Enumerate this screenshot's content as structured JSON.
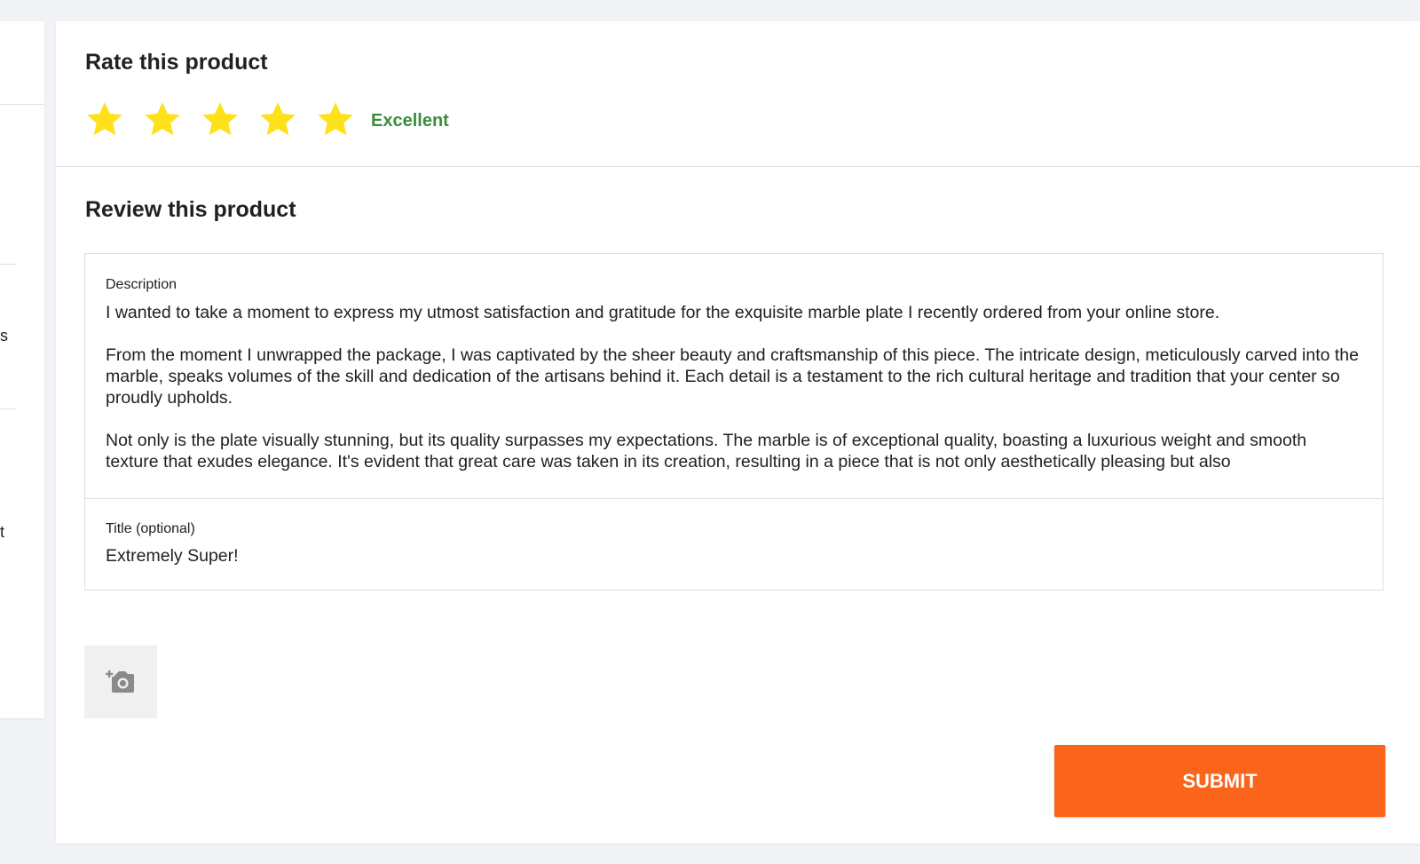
{
  "left_panel": {
    "glyphs": [
      "s",
      "t"
    ]
  },
  "rating": {
    "title": "Rate this product",
    "stars_filled": 5,
    "stars_total": 5,
    "label": "Excellent",
    "star_color": "#ffe11b",
    "label_color": "#388e3c"
  },
  "review": {
    "title": "Review this product",
    "description": {
      "label": "Description",
      "value": "I wanted to take a moment to express my utmost satisfaction and gratitude for the exquisite marble plate I recently ordered from your online store.\n\nFrom the moment I unwrapped the package, I was captivated by the sheer beauty and craftsmanship of this piece. The intricate design, meticulously carved into the marble, speaks volumes of the skill and dedication of the artisans behind it. Each detail is a testament to the rich cultural heritage and tradition that your center so proudly upholds.\n\nNot only is the plate visually stunning, but its quality surpasses my expectations. The marble is of exceptional quality, boasting a luxurious weight and smooth texture that exudes elegance. It's evident that great care was taken in its creation, resulting in a piece that is not only aesthetically pleasing but also"
    },
    "title_field": {
      "label": "Title (optional)",
      "value": "Extremely Super!"
    }
  },
  "photo_upload": {
    "icon": "add-photo-icon"
  },
  "submit": {
    "label": "SUBMIT",
    "color": "#fb641b"
  }
}
